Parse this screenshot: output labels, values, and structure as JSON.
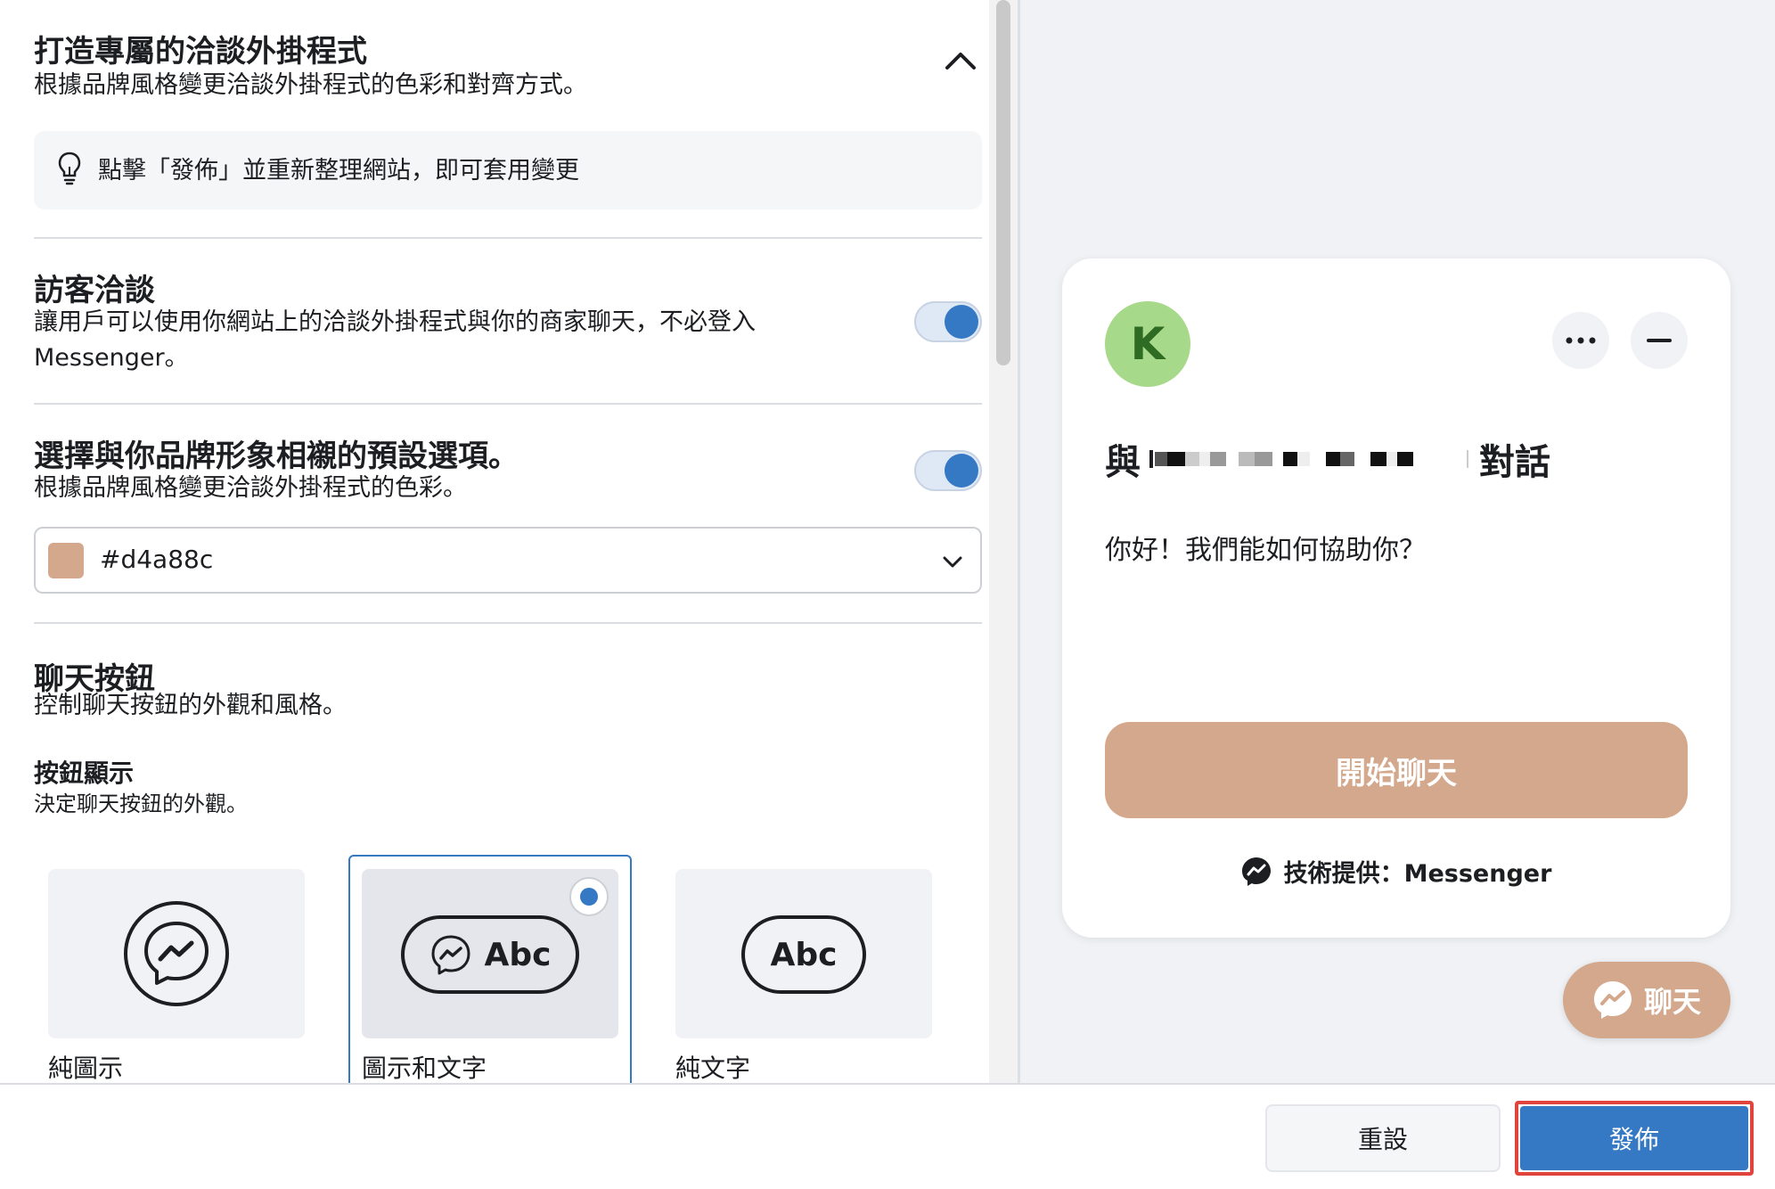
{
  "colors": {
    "accent": "#3578c4",
    "brand_color": "#d4a88c",
    "highlight": "#e0443c"
  },
  "customize_section": {
    "title": "打造專屬的洽談外掛程式",
    "description": "根據品牌風格變更洽談外掛程式的色彩和對齊方式。",
    "collapse_icon": "chevron-up-icon"
  },
  "tip": {
    "icon": "lightbulb-icon",
    "text": "點擊「發佈」並重新整理網站，即可套用變更"
  },
  "guest_chat": {
    "title": "訪客洽談",
    "description_line1": "讓用戶可以使用你網站上的洽談外掛程式與你的商家聊天，不必登入",
    "description_line2": "Messenger。",
    "enabled": true
  },
  "preset": {
    "title": "選擇與你品牌形象相襯的預設選項。",
    "description": "根據品牌風格變更洽談外掛程式的色彩。",
    "enabled": true,
    "selected_color": "#d4a88c"
  },
  "chat_button_section": {
    "title": "聊天按鈕",
    "description": "控制聊天按鈕的外觀和風格。",
    "display_title": "按鈕顯示",
    "display_description": "決定聊天按鈕的外觀。",
    "options": [
      {
        "label": "純圖示",
        "preview_text": "",
        "selected": false
      },
      {
        "label": "圖示和文字",
        "preview_text": "Abc",
        "selected": true
      },
      {
        "label": "純文字",
        "preview_text": "Abc",
        "selected": false
      }
    ]
  },
  "preview": {
    "avatar_letter": "K",
    "more_icon": "more-horizontal-icon",
    "minimize_icon": "minimize-icon",
    "title_prefix": "與",
    "title_suffix": "對話",
    "greeting": "你好！我們能如何協助你？",
    "start_chat_label": "開始聊天",
    "powered_by": "技術提供：Messenger",
    "floating_button_label": "聊天"
  },
  "footer": {
    "reset_label": "重設",
    "publish_label": "發佈"
  }
}
